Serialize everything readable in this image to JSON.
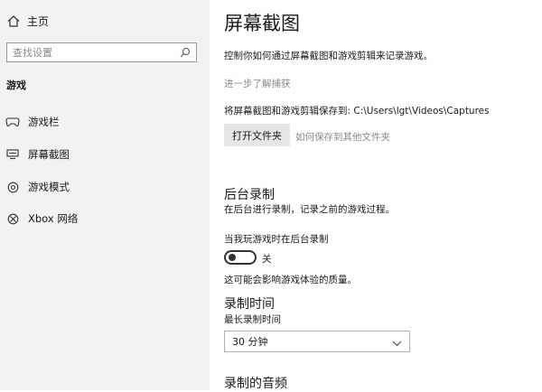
{
  "sidebar": {
    "home_label": "主页",
    "search_placeholder": "查找设置",
    "section_title": "游戏",
    "items": [
      {
        "label": "游戏栏",
        "icon": "game-bar-icon"
      },
      {
        "label": "屏幕截图",
        "icon": "captures-icon"
      },
      {
        "label": "游戏模式",
        "icon": "game-mode-icon"
      },
      {
        "label": "Xbox 网络",
        "icon": "xbox-icon"
      }
    ]
  },
  "main": {
    "title": "屏幕截图",
    "description": "控制你如何通过屏幕截图和游戏剪辑来记录游戏。",
    "learn_more": "进一步了解捕获",
    "save_path_text": "将屏幕截图和游戏剪辑保存到: C:\\Users\\lgt\\Videos\\Captures",
    "open_folder_button": "打开文件夹",
    "other_folder_link": "如何保存到其他文件夹",
    "background_recording": {
      "heading": "后台录制",
      "subtext": "在后台进行录制，记录之前的游戏过程。",
      "toggle_label": "当我玩游戏时在后台录制",
      "toggle_state": "关",
      "toggle_on": false,
      "note": "这可能会影响游戏体验的质量。"
    },
    "recording_time": {
      "heading": "录制时间",
      "subtext": "最长录制时间",
      "dropdown_value": "30 分钟"
    },
    "recorded_audio": {
      "heading": "录制的音频"
    }
  },
  "colors": {
    "sidebar_bg": "#f2f2f2",
    "link_gray": "#8a8a8a",
    "button_bg": "#e6e6e6"
  }
}
